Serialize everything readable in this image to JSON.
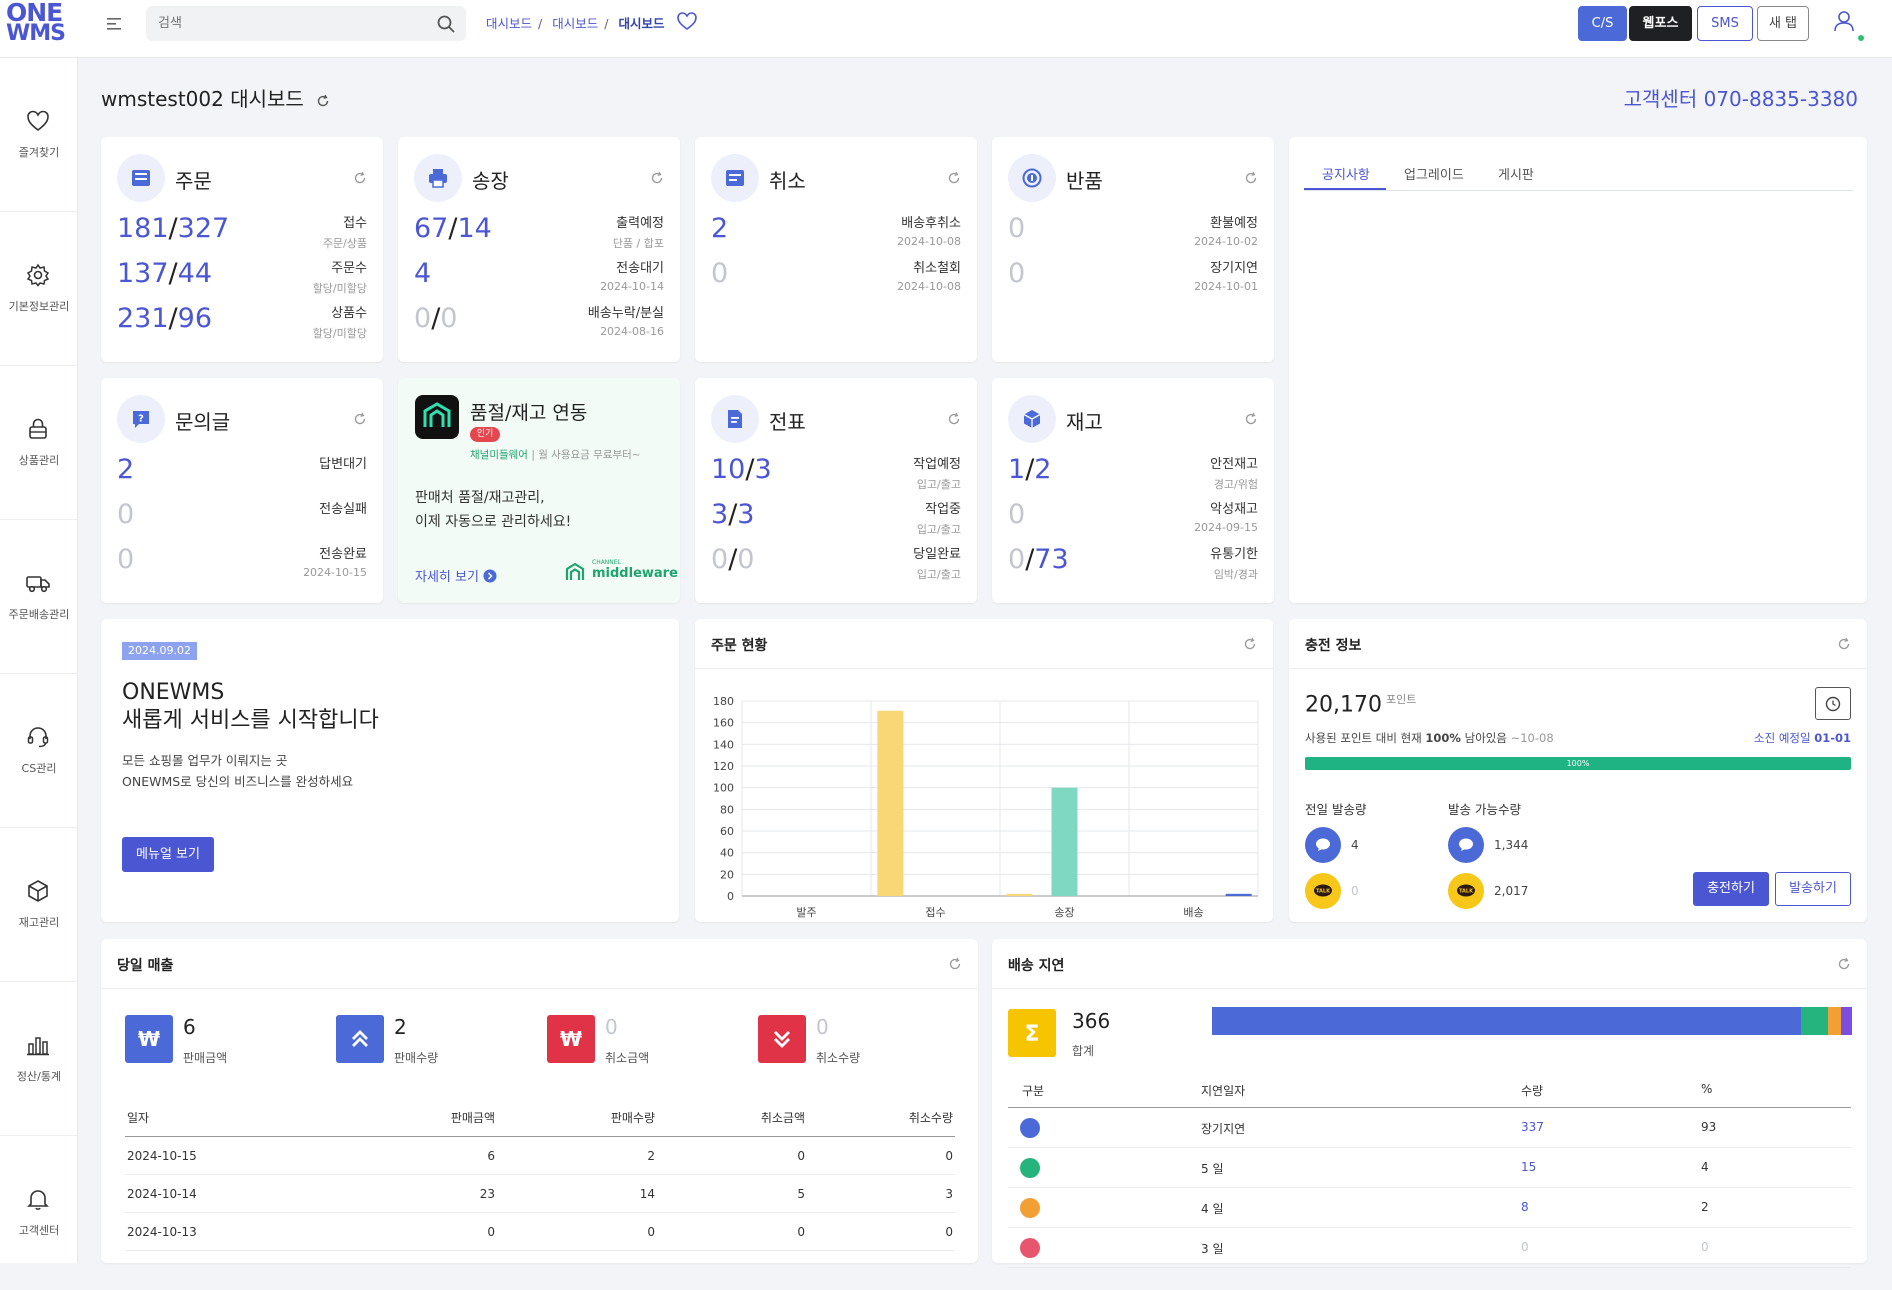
{
  "topbar": {
    "logo_line1": "ONE",
    "logo_line2": "WMS",
    "search_placeholder": "검색",
    "breadcrumb": [
      "대시보드",
      "대시보드",
      "대시보드"
    ],
    "buttons": {
      "cs": "C/S",
      "wp": "웹포스",
      "sms": "SMS",
      "nt": "새 탭"
    }
  },
  "sidebar": [
    {
      "label": "즐겨찾기",
      "icon": "heart-icon"
    },
    {
      "label": "기본정보관리",
      "icon": "gear-icon"
    },
    {
      "label": "상품관리",
      "icon": "lock-icon"
    },
    {
      "label": "주문배송관리",
      "icon": "truck-icon"
    },
    {
      "label": "CS관리",
      "icon": "headset-icon"
    },
    {
      "label": "재고관리",
      "icon": "box-icon"
    },
    {
      "label": "정산/통계",
      "icon": "bar-chart-icon"
    },
    {
      "label": "고객센터",
      "icon": "bell-icon"
    }
  ],
  "page": {
    "title": "wmstest002 대시보드",
    "cs_center": "고객센터 070-8835-3380"
  },
  "cards": {
    "order": {
      "title": "주문",
      "rows": [
        {
          "a": "181",
          "b": "327",
          "label": "접수",
          "sub": "주문/상품"
        },
        {
          "a": "137",
          "b": "44",
          "label": "주문수",
          "sub": "할당/미할당"
        },
        {
          "a": "231",
          "b": "96",
          "label": "상품수",
          "sub": "할당/미할당"
        }
      ]
    },
    "invoice": {
      "title": "송장",
      "rows": [
        {
          "a": "67",
          "b": "14",
          "label": "출력예정",
          "sub": "단품 / 합포"
        },
        {
          "a": "4",
          "b": "",
          "label": "전송대기",
          "sub": "2024-10-14"
        },
        {
          "a": "0",
          "b": "0",
          "label": "배송누락/분실",
          "sub": "2024-08-16"
        }
      ]
    },
    "cancel": {
      "title": "취소",
      "rows": [
        {
          "a": "2",
          "label": "배송후취소",
          "sub": "2024-10-08"
        },
        {
          "a": "0",
          "label": "취소철회",
          "sub": "2024-10-08"
        }
      ]
    },
    "return": {
      "title": "반품",
      "rows": [
        {
          "a": "0",
          "label": "환불예정",
          "sub": "2024-10-02"
        },
        {
          "a": "0",
          "label": "장기지연",
          "sub": "2024-10-01"
        }
      ]
    },
    "inquiry": {
      "title": "문의글",
      "rows": [
        {
          "a": "2",
          "label": "답변대기",
          "sub": ""
        },
        {
          "a": "0",
          "label": "전송실패",
          "sub": ""
        },
        {
          "a": "0",
          "label": "전송완료",
          "sub": "2024-10-15"
        }
      ]
    },
    "promo": {
      "title": "품절/재고 연동",
      "badge": "인기",
      "sub1": "채널미들웨어",
      "sub2": "| 월 사용요금 무료부터~",
      "desc1": "판매처 품절/재고관리,",
      "desc2": "이제 자동으로 관리하세요!",
      "link": "자세히 보기",
      "brand_small": "CHANNEL",
      "brand": "middleware"
    },
    "slip": {
      "title": "전표",
      "rows": [
        {
          "a": "10",
          "b": "3",
          "label": "작업예정",
          "sub": "입고/출고"
        },
        {
          "a": "3",
          "b": "3",
          "label": "작업중",
          "sub": "입고/출고"
        },
        {
          "a": "0",
          "b": "0",
          "label": "당일완료",
          "sub": "입고/출고"
        }
      ]
    },
    "stock": {
      "title": "재고",
      "rows": [
        {
          "a": "1",
          "b": "2",
          "label": "안전재고",
          "sub": "경고/위험"
        },
        {
          "a": "0",
          "b": "",
          "label": "악성재고",
          "sub": "2024-09-15"
        },
        {
          "a": "0",
          "b": "73",
          "label": "유통기한",
          "sub": "임박/경과"
        }
      ]
    }
  },
  "notice": {
    "tabs": [
      "공지사항",
      "업그레이드",
      "게시판"
    ]
  },
  "banner": {
    "date": "2024.09.02",
    "title1": "ONEWMS",
    "title2": "새롭게 서비스를 시작합니다",
    "desc1": "모든 쇼핑몰 업무가 이뤄지는 곳",
    "desc2": "ONEWMS로 당신의 비즈니스를 완성하세요",
    "button": "메뉴얼 보기"
  },
  "order_status": {
    "title": "주문 현황"
  },
  "chart_data": {
    "type": "bar",
    "categories": [
      "발주",
      "접수",
      "송장",
      "배송"
    ],
    "series": [
      {
        "color": "#f9d776",
        "values": [
          0,
          171,
          2,
          0
        ]
      },
      {
        "color": "#7fd8c1",
        "values": [
          0,
          0,
          100,
          0
        ]
      },
      {
        "color": "#4b6ad8",
        "values": [
          0,
          0,
          0,
          2
        ]
      }
    ],
    "ylim": [
      0,
      180
    ],
    "yticks": [
      0,
      20,
      40,
      60,
      80,
      100,
      120,
      140,
      160,
      180
    ]
  },
  "charge": {
    "title": "충전 정보",
    "points": "20,170",
    "points_unit": "포인트",
    "desc_pre": "사용된 포인트 대비 현재",
    "desc_pct": "100%",
    "desc_post": "남아있음",
    "desc_date": "~10-08",
    "expire_label": "소진 예정일",
    "expire_date": "01-01",
    "progress_label": "100%",
    "progress": 1.0,
    "prev_label": "전일 발송량",
    "avail_label": "발송 가능수량",
    "prev_sms": "4",
    "prev_kakao": "0",
    "avail_sms": "1,344",
    "avail_kakao": "2,017",
    "kakao_text": "TALK",
    "btn_charge": "충전하기",
    "btn_send": "발송하기"
  },
  "sales": {
    "title": "당일 매출",
    "kpis": [
      {
        "value": "6",
        "label": "판매금액",
        "color": "#4b6ad8"
      },
      {
        "value": "2",
        "label": "판매수량",
        "color": "#4b6ad8"
      },
      {
        "value": "0",
        "label": "취소금액",
        "color": "#e03348"
      },
      {
        "value": "0",
        "label": "취소수량",
        "color": "#e03348"
      }
    ],
    "headers": [
      "일자",
      "판매금액",
      "판매수량",
      "취소금액",
      "취소수량"
    ],
    "rows": [
      [
        "2024-10-15",
        "6",
        "2",
        "0",
        "0"
      ],
      [
        "2024-10-14",
        "23",
        "14",
        "5",
        "3"
      ],
      [
        "2024-10-13",
        "0",
        "0",
        "0",
        "0"
      ]
    ]
  },
  "delay": {
    "title": "배송 지연",
    "total": "366",
    "total_label": "합계",
    "segments": [
      {
        "color": "#4b6ad8",
        "value": 337
      },
      {
        "color": "#25b47e",
        "value": 15
      },
      {
        "color": "#f2a033",
        "value": 8
      },
      {
        "color": "#7a4fe0",
        "value": 6
      }
    ],
    "headers": [
      "구분",
      "지연일자",
      "수량",
      "%"
    ],
    "rows": [
      {
        "color": "#4b6ad8",
        "name": "장기지연",
        "qty": "337",
        "pct": "93",
        "muted": false
      },
      {
        "color": "#25b47e",
        "name": "5 일",
        "qty": "15",
        "pct": "4",
        "muted": false
      },
      {
        "color": "#f2a033",
        "name": "4 일",
        "qty": "8",
        "pct": "2",
        "muted": false
      },
      {
        "color": "#e8556e",
        "name": "3 일",
        "qty": "0",
        "pct": "0",
        "muted": true
      }
    ]
  }
}
